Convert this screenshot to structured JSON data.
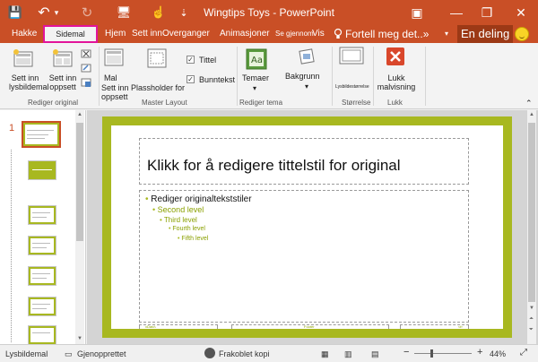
{
  "titlebar": {
    "title": "Wingtips Toys  -  PowerPoint",
    "qat": {
      "save": "💾",
      "undo": "↶",
      "undo_arrow": "▾",
      "redo": "↻",
      "presenter": "🖥",
      "touch": "☝",
      "more": "⇣"
    },
    "controls": {
      "ribbon_display": "▣",
      "minimize": "—",
      "restore": "❐",
      "close": "✕"
    }
  },
  "tabs": {
    "file": "Hakke",
    "active": "Sidemal",
    "home": "Hjem",
    "insert": "Sett inn",
    "transitions": "Overganger",
    "animations": "Animasjoner",
    "review": "Se gjennom",
    "view": "Vis",
    "tell": "Fortell meg det..»",
    "share": "En deling"
  },
  "ribbon": {
    "insert_slide_master": "Sett inn lysbildemal",
    "insert_layout": "Sett inn oppsett",
    "group_edit_master": "Rediger original",
    "master": "Mal",
    "insert_placeholder": "Sett inn Plassholder for oppsett",
    "title_check": "Tittel",
    "footers_check": "Bunntekst",
    "group_master_layout": "Master Layout",
    "themes": "Temaer",
    "group_edit_theme": "Rediger tema",
    "background": "Bakgrunn",
    "slide_size": "Lysbildestørrelse",
    "group_size": "Størrelse",
    "close_master": "Lukk malvisning",
    "group_close": "Lukk"
  },
  "slide_panel": {
    "number": "1"
  },
  "slide": {
    "title": "Klikk for å redigere tittelstil for original",
    "levels": [
      "Rediger originaltekststiler",
      "Second level",
      "Third level",
      "Fourth level",
      "Fifth level"
    ],
    "bullet": "•",
    "footer_left": "xDato\\",
    "footer_center": "Footer",
    "footer_right": "‹#›"
  },
  "status": {
    "view": "Lysbildemal",
    "regenerated": "Gjenopprettet",
    "offline": "Frakoblet kopi",
    "zoom_out": "−",
    "zoom_in": "+",
    "zoom": "44%",
    "fit": "⤢"
  },
  "colors": {
    "accent": "#c94f26",
    "slide_green": "#a8b820",
    "close_red": "#d9472b"
  }
}
